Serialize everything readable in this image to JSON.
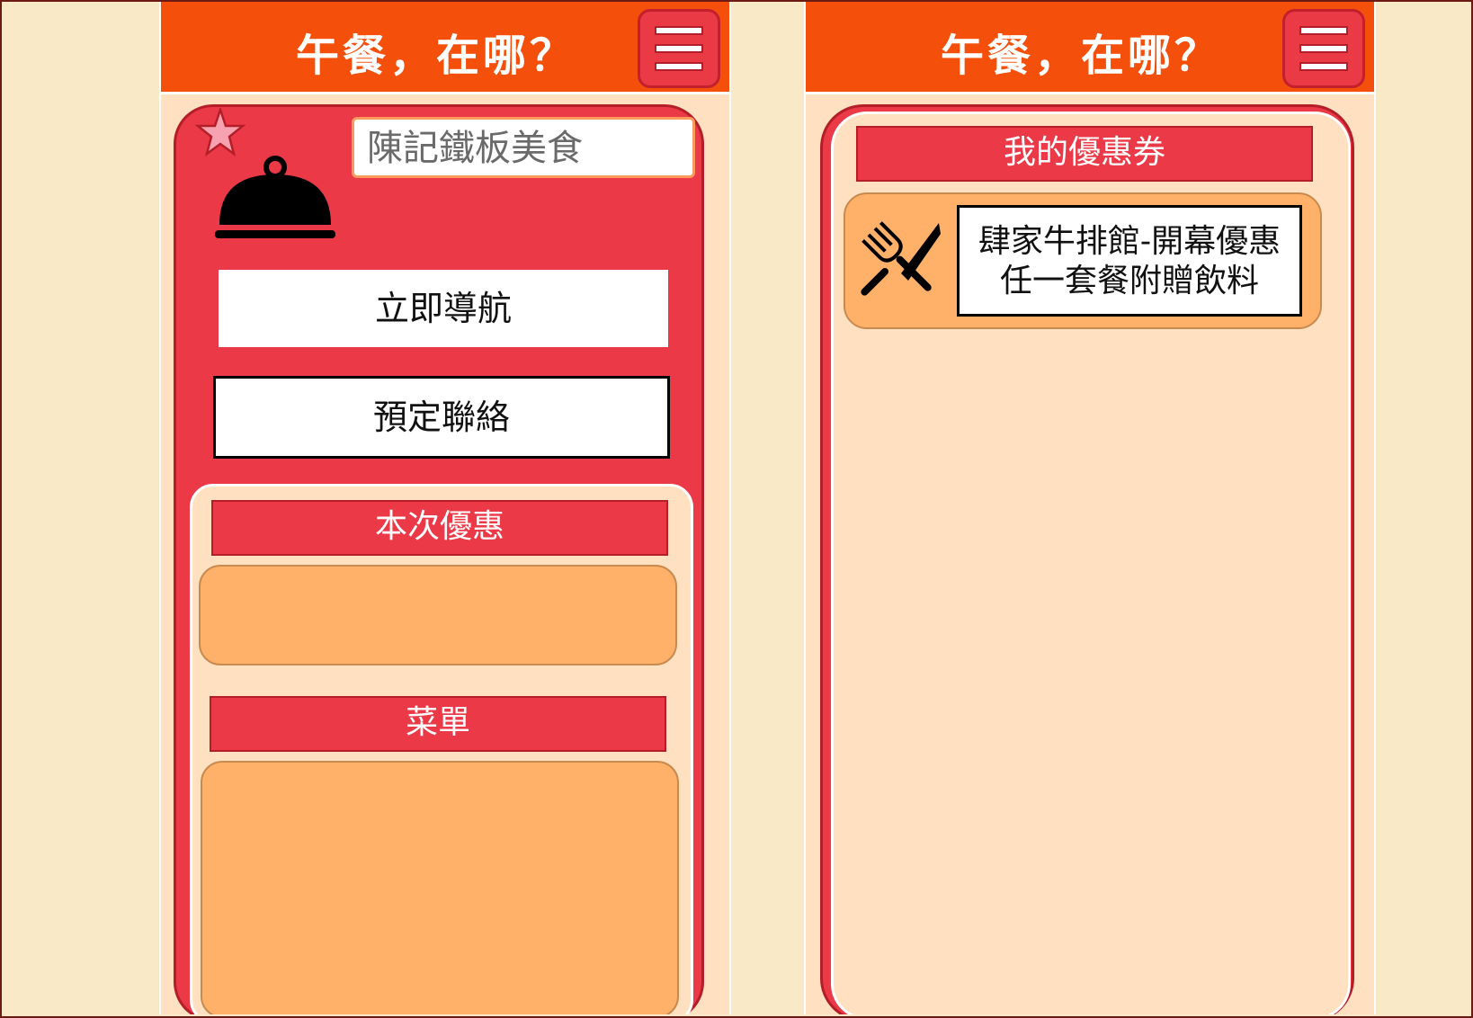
{
  "app": {
    "title": "午餐，在哪？"
  },
  "left_screen": {
    "search_value": "陳記鐵板美食",
    "navigate_button": "立即導航",
    "reserve_button": "預定聯絡",
    "promo_section_title": "本次優惠",
    "menu_section_title": "菜單"
  },
  "right_screen": {
    "coupons_title": "我的優惠券",
    "coupons": [
      {
        "line1": "肆家牛排館-開幕優惠",
        "line2": "任一套餐附贈飲料"
      }
    ]
  },
  "colors": {
    "header": "#f4500b",
    "card_red": "#ec3947",
    "panel_bg": "#ffe0c0",
    "orange_box": "#ffb169",
    "page_bg": "#f9e9c6"
  },
  "icons": [
    "menu-icon",
    "star-icon",
    "cloche-icon",
    "cutlery-icon"
  ]
}
